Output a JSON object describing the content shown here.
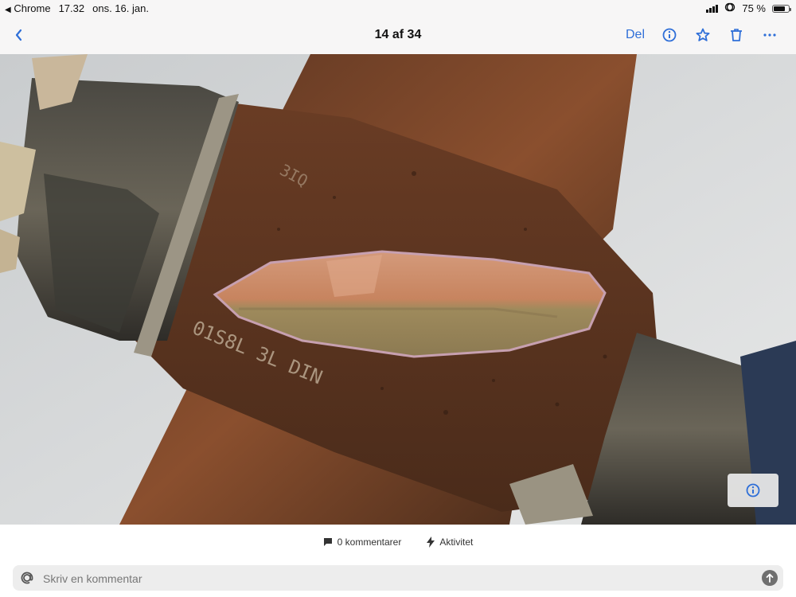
{
  "status_bar": {
    "app": "Chrome",
    "time": "17.32",
    "date": "ons. 16. jan.",
    "battery": "75 %",
    "battery_level": 0.75
  },
  "nav": {
    "title": "14 af 34",
    "share_label": "Del",
    "icons": [
      "chevron-left-icon",
      "info-icon",
      "star-icon",
      "trash-icon",
      "more-icon"
    ]
  },
  "photo": {
    "stamp_text": "01S8L 3L DIN",
    "stamp_text_2": "3IQ"
  },
  "footer": {
    "comments_label": "0 kommentarer",
    "activity_label": "Aktivitet",
    "comment_placeholder": "Skriv en kommentar"
  },
  "colors": {
    "accent": "#2f6fd8",
    "rust": "#7a4326",
    "copper": "#c98a6a"
  }
}
